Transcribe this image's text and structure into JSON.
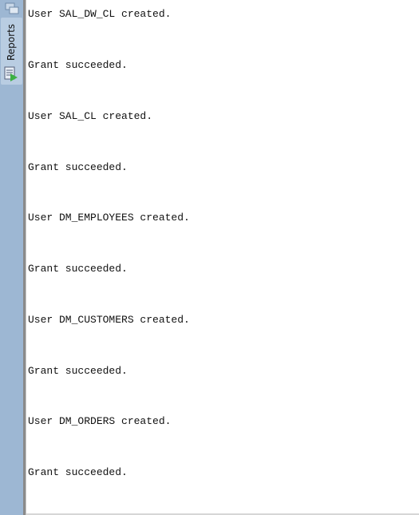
{
  "sidebar": {
    "tab_label": "Reports"
  },
  "output": {
    "lines": [
      "User SAL_DW_CL created.",
      "Grant succeeded.",
      "User SAL_CL created.",
      "Grant succeeded.",
      "User DM_EMPLOYEES created.",
      "Grant succeeded.",
      "User DM_CUSTOMERS created.",
      "Grant succeeded.",
      "User DM_ORDERS created.",
      "Grant succeeded."
    ]
  }
}
